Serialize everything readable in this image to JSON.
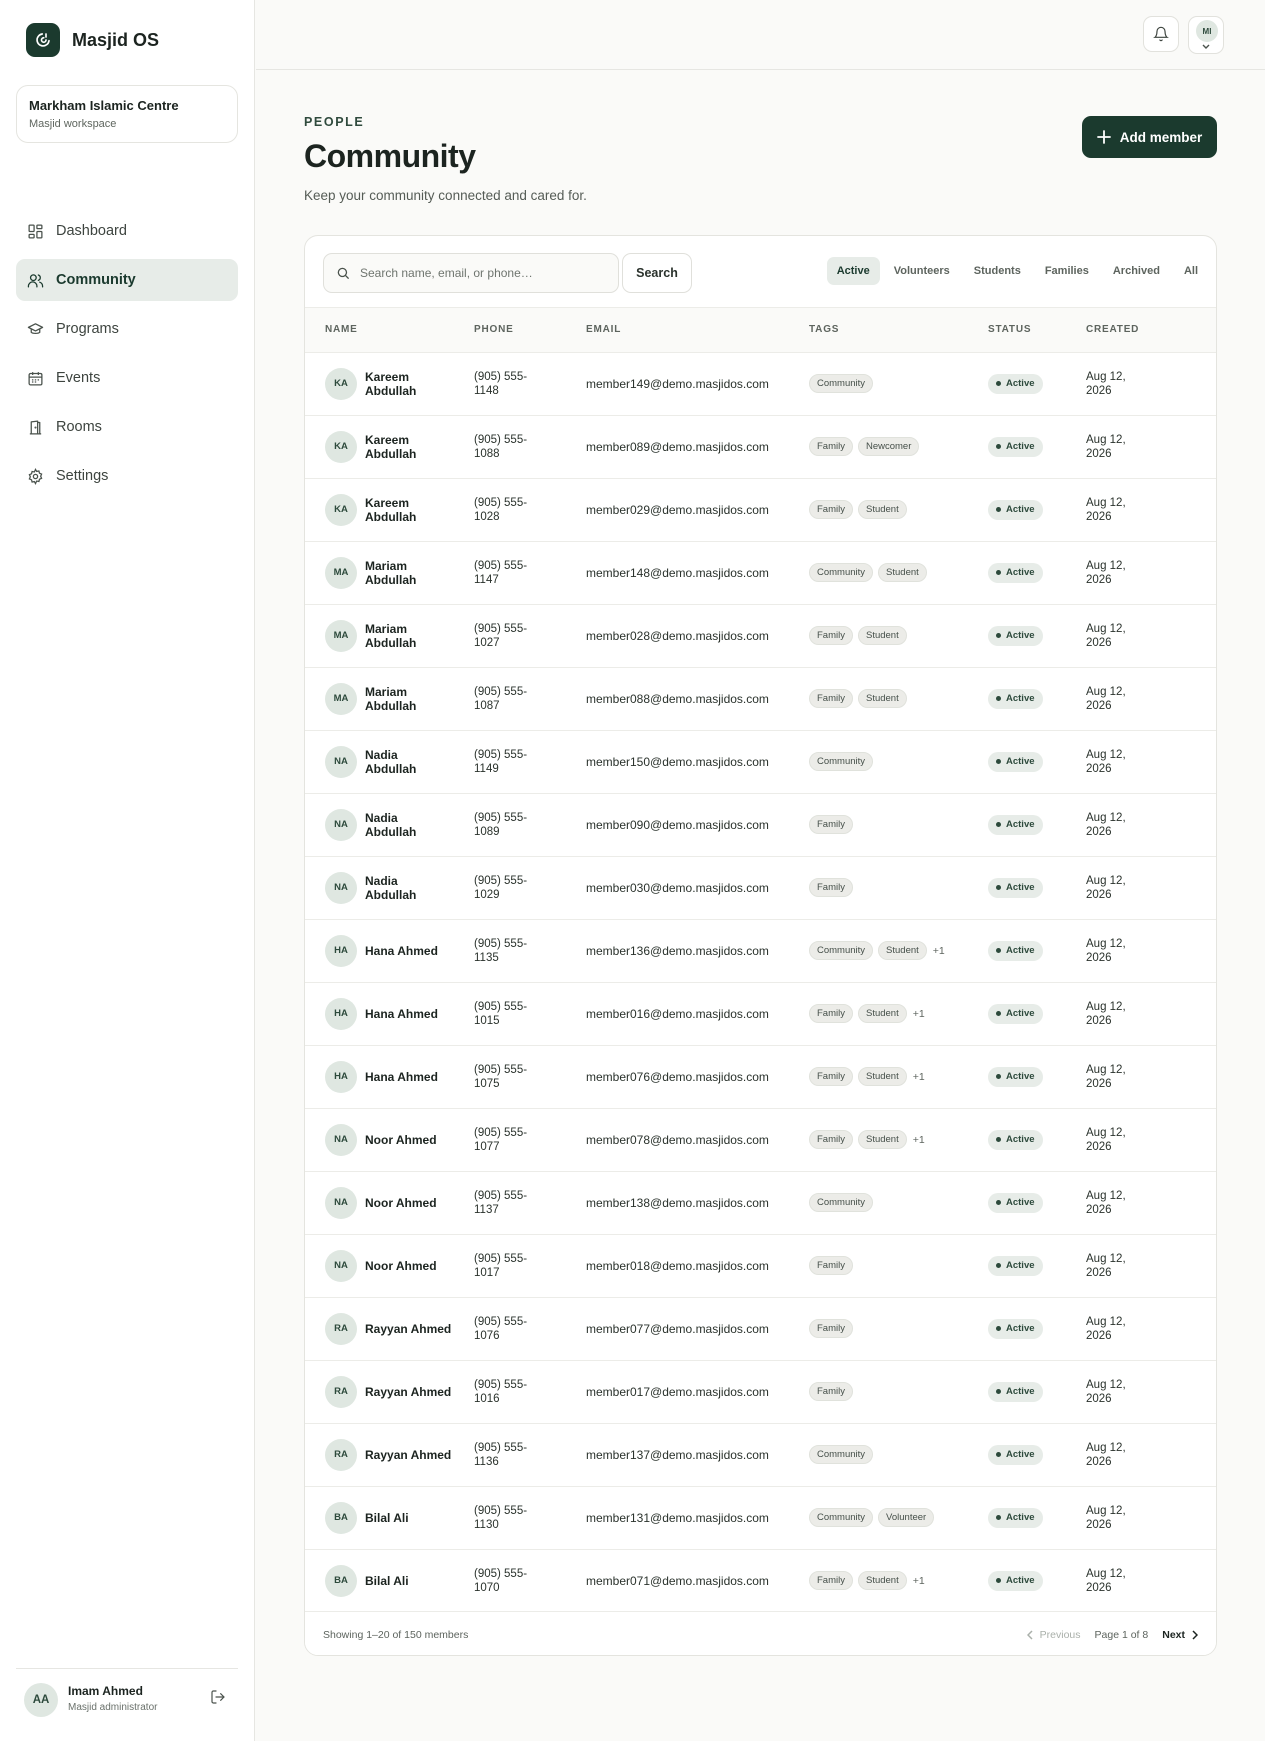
{
  "brand": {
    "name": "Masjid OS"
  },
  "workspace": {
    "name": "Markham Islamic Centre",
    "subtitle": "Masjid workspace"
  },
  "nav": [
    {
      "label": "Dashboard",
      "icon": "dashboard-icon",
      "active": false
    },
    {
      "label": "Community",
      "icon": "users-icon",
      "active": true
    },
    {
      "label": "Programs",
      "icon": "graduation-cap-icon",
      "active": false
    },
    {
      "label": "Events",
      "icon": "calendar-icon",
      "active": false
    },
    {
      "label": "Rooms",
      "icon": "door-icon",
      "active": false
    },
    {
      "label": "Settings",
      "icon": "gear-icon",
      "active": false
    }
  ],
  "user": {
    "initials": "AA",
    "name": "Imam Ahmed",
    "role": "Masjid administrator"
  },
  "topbar": {
    "profile_initials": "MI"
  },
  "header": {
    "eyebrow": "PEOPLE",
    "title": "Community",
    "subtitle": "Keep your community connected and cared for.",
    "add_label": "Add member"
  },
  "search": {
    "placeholder": "Search name, email, or phone…",
    "button_label": "Search"
  },
  "filters": [
    {
      "label": "Active",
      "active": true
    },
    {
      "label": "Volunteers",
      "active": false
    },
    {
      "label": "Students",
      "active": false
    },
    {
      "label": "Families",
      "active": false
    },
    {
      "label": "Archived",
      "active": false
    },
    {
      "label": "All",
      "active": false
    }
  ],
  "table": {
    "columns": [
      "NAME",
      "PHONE",
      "EMAIL",
      "TAGS",
      "STATUS",
      "CREATED"
    ],
    "rows": [
      {
        "initials": "KA",
        "name": "Kareem Abdullah",
        "phone": "(905) 555-1148",
        "email": "member149@demo.masjidos.com",
        "tags": [
          "Community"
        ],
        "more": "",
        "status": "Active",
        "created": "Aug 12, 2026"
      },
      {
        "initials": "KA",
        "name": "Kareem Abdullah",
        "phone": "(905) 555-1088",
        "email": "member089@demo.masjidos.com",
        "tags": [
          "Family",
          "Newcomer"
        ],
        "more": "",
        "status": "Active",
        "created": "Aug 12, 2026"
      },
      {
        "initials": "KA",
        "name": "Kareem Abdullah",
        "phone": "(905) 555-1028",
        "email": "member029@demo.masjidos.com",
        "tags": [
          "Family",
          "Student"
        ],
        "more": "",
        "status": "Active",
        "created": "Aug 12, 2026"
      },
      {
        "initials": "MA",
        "name": "Mariam Abdullah",
        "phone": "(905) 555-1147",
        "email": "member148@demo.masjidos.com",
        "tags": [
          "Community",
          "Student"
        ],
        "more": "",
        "status": "Active",
        "created": "Aug 12, 2026"
      },
      {
        "initials": "MA",
        "name": "Mariam Abdullah",
        "phone": "(905) 555-1027",
        "email": "member028@demo.masjidos.com",
        "tags": [
          "Family",
          "Student"
        ],
        "more": "",
        "status": "Active",
        "created": "Aug 12, 2026"
      },
      {
        "initials": "MA",
        "name": "Mariam Abdullah",
        "phone": "(905) 555-1087",
        "email": "member088@demo.masjidos.com",
        "tags": [
          "Family",
          "Student"
        ],
        "more": "",
        "status": "Active",
        "created": "Aug 12, 2026"
      },
      {
        "initials": "NA",
        "name": "Nadia Abdullah",
        "phone": "(905) 555-1149",
        "email": "member150@demo.masjidos.com",
        "tags": [
          "Community"
        ],
        "more": "",
        "status": "Active",
        "created": "Aug 12, 2026"
      },
      {
        "initials": "NA",
        "name": "Nadia Abdullah",
        "phone": "(905) 555-1089",
        "email": "member090@demo.masjidos.com",
        "tags": [
          "Family"
        ],
        "more": "",
        "status": "Active",
        "created": "Aug 12, 2026"
      },
      {
        "initials": "NA",
        "name": "Nadia Abdullah",
        "phone": "(905) 555-1029",
        "email": "member030@demo.masjidos.com",
        "tags": [
          "Family"
        ],
        "more": "",
        "status": "Active",
        "created": "Aug 12, 2026"
      },
      {
        "initials": "HA",
        "name": "Hana Ahmed",
        "phone": "(905) 555-1135",
        "email": "member136@demo.masjidos.com",
        "tags": [
          "Community",
          "Student"
        ],
        "more": "+1",
        "status": "Active",
        "created": "Aug 12, 2026"
      },
      {
        "initials": "HA",
        "name": "Hana Ahmed",
        "phone": "(905) 555-1015",
        "email": "member016@demo.masjidos.com",
        "tags": [
          "Family",
          "Student"
        ],
        "more": "+1",
        "status": "Active",
        "created": "Aug 12, 2026"
      },
      {
        "initials": "HA",
        "name": "Hana Ahmed",
        "phone": "(905) 555-1075",
        "email": "member076@demo.masjidos.com",
        "tags": [
          "Family",
          "Student"
        ],
        "more": "+1",
        "status": "Active",
        "created": "Aug 12, 2026"
      },
      {
        "initials": "NA",
        "name": "Noor Ahmed",
        "phone": "(905) 555-1077",
        "email": "member078@demo.masjidos.com",
        "tags": [
          "Family",
          "Student"
        ],
        "more": "+1",
        "status": "Active",
        "created": "Aug 12, 2026"
      },
      {
        "initials": "NA",
        "name": "Noor Ahmed",
        "phone": "(905) 555-1137",
        "email": "member138@demo.masjidos.com",
        "tags": [
          "Community"
        ],
        "more": "",
        "status": "Active",
        "created": "Aug 12, 2026"
      },
      {
        "initials": "NA",
        "name": "Noor Ahmed",
        "phone": "(905) 555-1017",
        "email": "member018@demo.masjidos.com",
        "tags": [
          "Family"
        ],
        "more": "",
        "status": "Active",
        "created": "Aug 12, 2026"
      },
      {
        "initials": "RA",
        "name": "Rayyan Ahmed",
        "phone": "(905) 555-1076",
        "email": "member077@demo.masjidos.com",
        "tags": [
          "Family"
        ],
        "more": "",
        "status": "Active",
        "created": "Aug 12, 2026"
      },
      {
        "initials": "RA",
        "name": "Rayyan Ahmed",
        "phone": "(905) 555-1016",
        "email": "member017@demo.masjidos.com",
        "tags": [
          "Family"
        ],
        "more": "",
        "status": "Active",
        "created": "Aug 12, 2026"
      },
      {
        "initials": "RA",
        "name": "Rayyan Ahmed",
        "phone": "(905) 555-1136",
        "email": "member137@demo.masjidos.com",
        "tags": [
          "Community"
        ],
        "more": "",
        "status": "Active",
        "created": "Aug 12, 2026"
      },
      {
        "initials": "BA",
        "name": "Bilal Ali",
        "phone": "(905) 555-1130",
        "email": "member131@demo.masjidos.com",
        "tags": [
          "Community",
          "Volunteer"
        ],
        "more": "",
        "status": "Active",
        "created": "Aug 12, 2026"
      },
      {
        "initials": "BA",
        "name": "Bilal Ali",
        "phone": "(905) 555-1070",
        "email": "member071@demo.masjidos.com",
        "tags": [
          "Family",
          "Student"
        ],
        "more": "+1",
        "status": "Active",
        "created": "Aug 12, 2026"
      }
    ]
  },
  "pagination": {
    "showing": "Showing 1–20 of 150 members",
    "previous_label": "Previous",
    "page_info": "Page 1 of 8",
    "next_label": "Next"
  },
  "colors": {
    "accent": "#1b3a2e",
    "accent_soft": "#e7ece8",
    "background": "#fafaf8"
  }
}
